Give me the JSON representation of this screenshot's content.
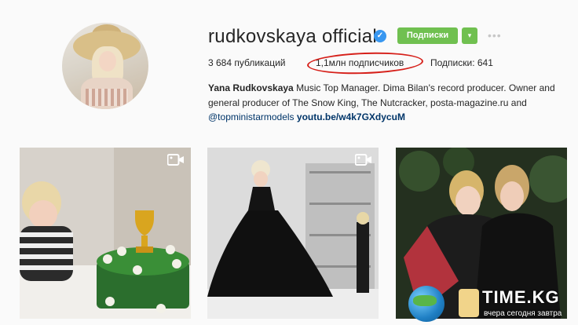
{
  "profile": {
    "username": "rudkovskaya official",
    "verified_glyph": "✓",
    "follow_label": "Подписки",
    "dropdown_glyph": "▾",
    "more_glyph": "•••"
  },
  "stats": {
    "posts": "3 684 публикаций",
    "followers": "1,1млн подписчиков",
    "following": "Подписки: 641"
  },
  "bio": {
    "name": "Yana Rudkovskaya",
    "text_line1": " Music Top Manager. Dima Bilan's record producer. Owner and",
    "text_line2": "general producer of The Snow King, The Nutcracker, posta-magazine.ru and",
    "mention": "@topministarmodels",
    "link": "youtu.be/w4k7GXdycuM"
  },
  "posts": [
    {
      "type": "video",
      "icon": "video-camera-icon"
    },
    {
      "type": "video",
      "icon": "video-camera-icon"
    },
    {
      "type": "photo"
    }
  ],
  "watermark": {
    "title": "TIME.KG",
    "subtitle": "вчера сегодня завтра"
  },
  "colors": {
    "follow_green": "#70c050",
    "verified_blue": "#3897f0",
    "annotation_red": "#d6201a"
  }
}
